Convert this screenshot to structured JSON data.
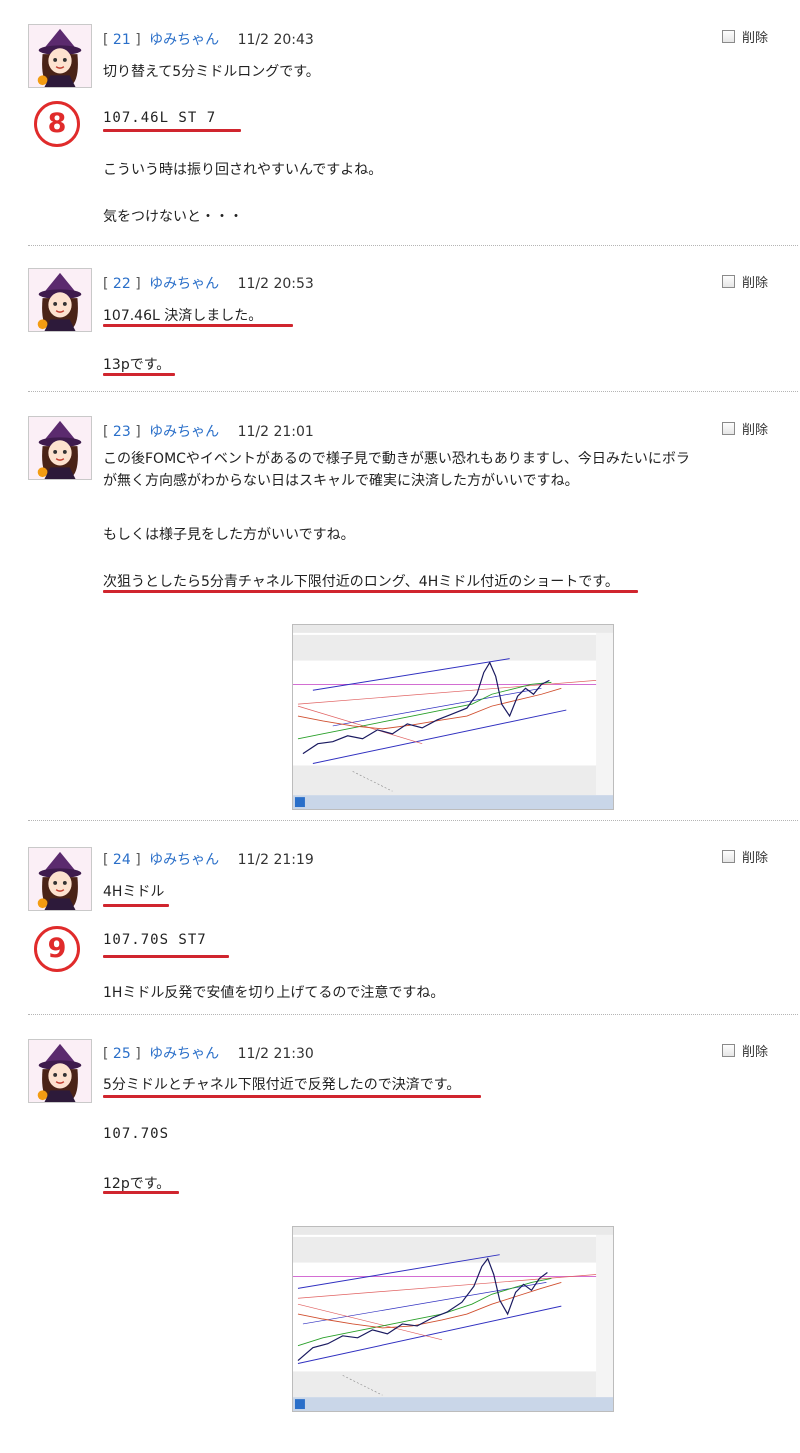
{
  "posts": [
    {
      "number": "21",
      "author": "ゆみちゃん",
      "time": "11/2 20:43",
      "lines": [
        "切り替えて5分ミドルロングです。",
        "107.46L ST 7",
        "こういう時は振り回されやすいんですよね。",
        "気をつけないと・・・"
      ],
      "marker": "8"
    },
    {
      "number": "22",
      "author": "ゆみちゃん",
      "time": "11/2 20:53",
      "lines": [
        "107.46L 決済しました。",
        "13pです。"
      ]
    },
    {
      "number": "23",
      "author": "ゆみちゃん",
      "time": "11/2 21:01",
      "lines": [
        "この後FOMCやイベントがあるので様子見で動きが悪い恐れもありますし、今日みたいにボラが無く方向感がわからない日はスキャルで確実に決済した方がいいですね。",
        "もしくは様子見をした方がいいですね。",
        "次狙うとしたら5分青チャネル下限付近のロング、4Hミドル付近のショートです。"
      ]
    },
    {
      "number": "24",
      "author": "ゆみちゃん",
      "time": "11/2 21:19",
      "lines": [
        "4Hミドル",
        "107.70S ST7",
        "1Hミドル反発で安値を切り上げてるので注意ですね。"
      ],
      "marker": "9"
    },
    {
      "number": "25",
      "author": "ゆみちゃん",
      "time": "11/2 21:30",
      "lines": [
        "5分ミドルとチャネル下限付近で反発したので決済です。",
        "107.70S",
        "12pです。"
      ]
    }
  ],
  "delete_label": "削除",
  "bracket_open": "[",
  "bracket_close": "]",
  "colors": {
    "link": "#2a6fc9",
    "underline": "#d0252e",
    "marker": "#e02b2b",
    "separator": "#b5b5b5"
  },
  "icons": {
    "avatar": "avatar-girl-witch-hat",
    "checkbox": "checkbox-icon"
  }
}
